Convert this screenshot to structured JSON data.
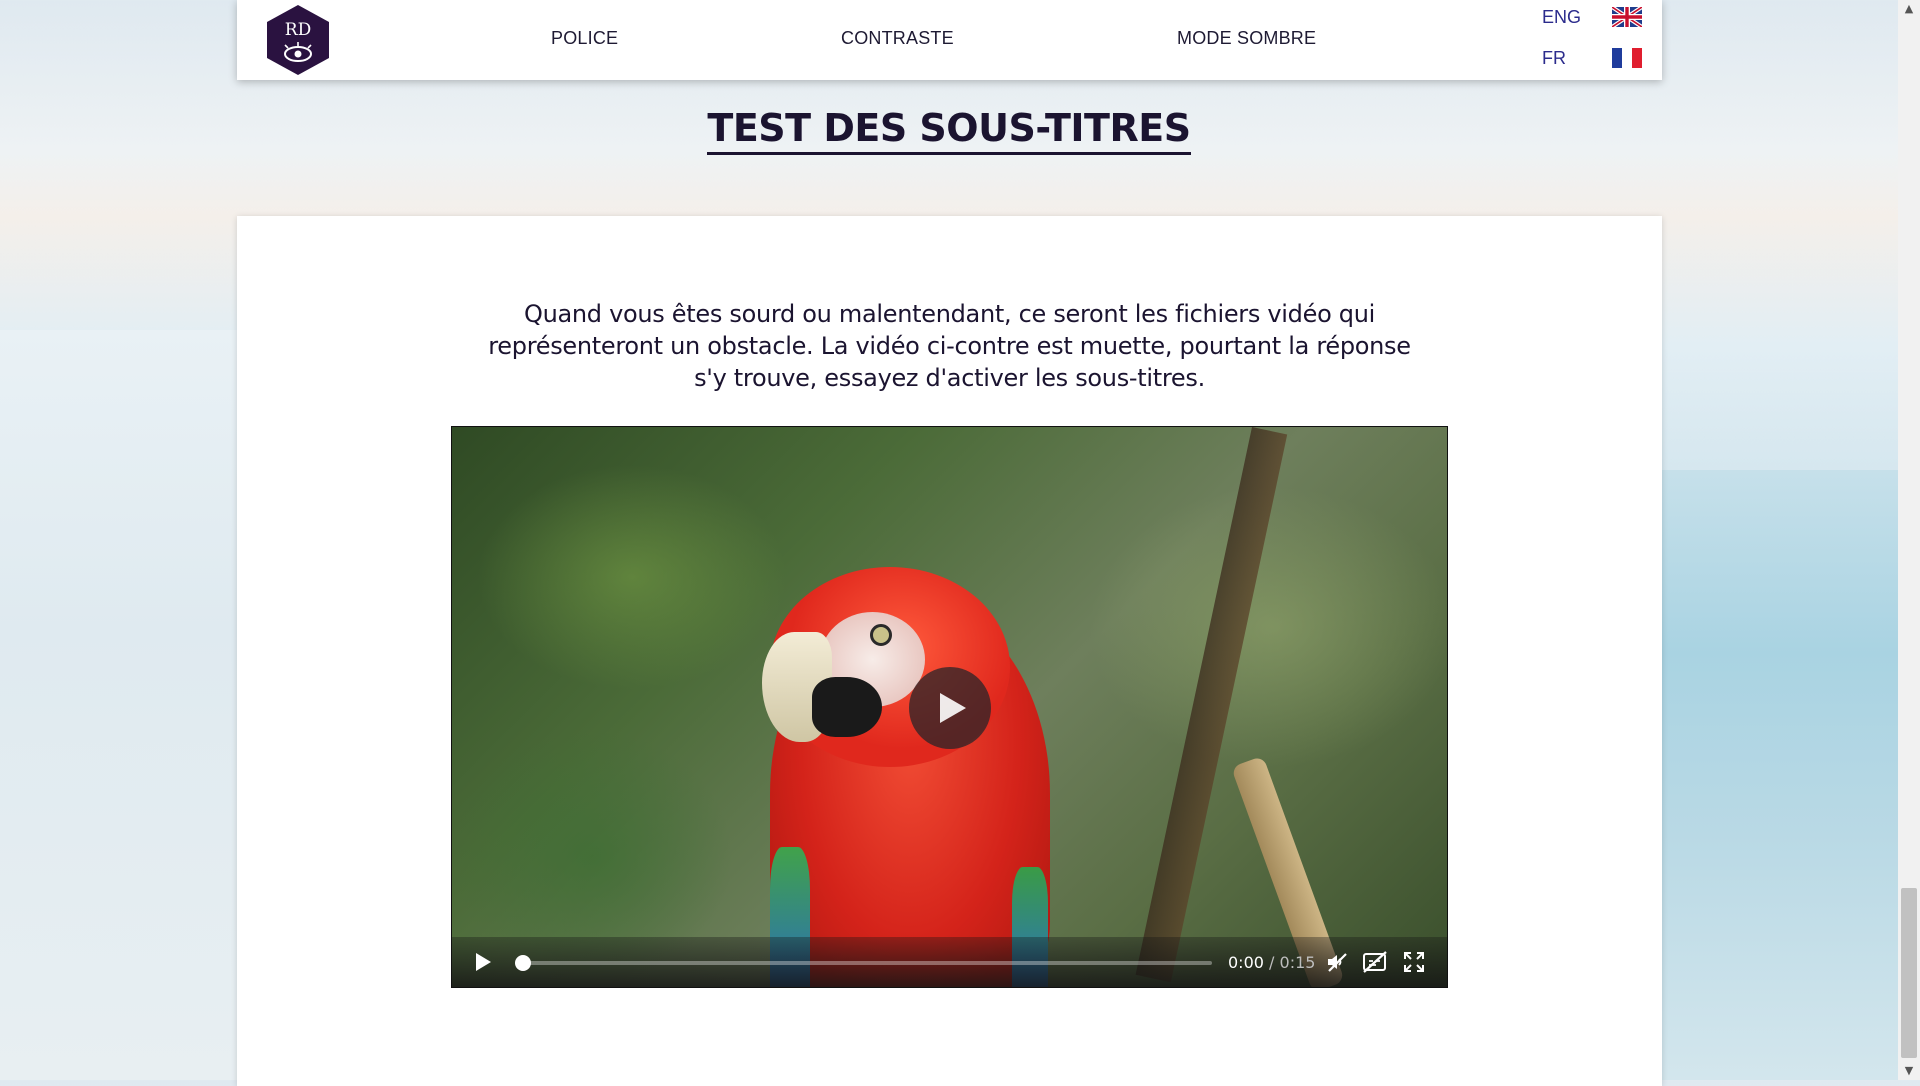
{
  "nav": {
    "logo_text": "RD",
    "links": [
      "POLICE",
      "CONTRASTE",
      "MODE SOMBRE"
    ],
    "languages": [
      {
        "label": "ENG",
        "flag": "uk-flag-icon"
      },
      {
        "label": "FR",
        "flag": "france-flag-icon"
      }
    ]
  },
  "page": {
    "title": "TEST DES SOUS-TITRES",
    "intro": "Quand vous êtes sourd ou malentendant, ce seront les fichiers vidéo qui représenteront un obstacle. La vidéo ci-contre est muette, pourtant la réponse s'y trouve, essayez d'activer les sous-titres."
  },
  "video": {
    "current_time": "0:00",
    "separator": "/",
    "duration": "0:15",
    "progress": 0.0,
    "muted": true,
    "captions_enabled": false
  },
  "colors": {
    "logo_bg": "#2a1240",
    "title": "#1b1430",
    "lang_link": "#2b2b8c"
  }
}
